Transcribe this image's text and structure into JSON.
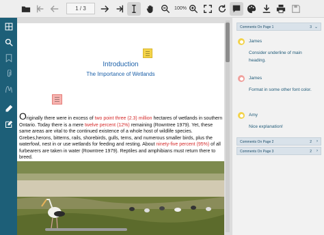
{
  "toolbar": {
    "page_indicator": "1 / 3",
    "zoom_level": "100%",
    "icons": [
      "folder-open-icon",
      "first-page-icon",
      "previous-page-icon",
      "next-page-icon",
      "last-page-icon",
      "text-select-icon",
      "pan-hand-icon",
      "zoom-out-icon",
      "zoom-in-icon",
      "fit-page-icon",
      "rotate-icon",
      "comments-panel-icon",
      "palette-icon",
      "download-icon",
      "print-icon",
      "save-icon"
    ]
  },
  "sidebar": {
    "icons": [
      "thumbnails-icon",
      "search-icon",
      "bookmark-icon",
      "attachment-icon",
      "signature-icon",
      "annotate-pen-icon",
      "edit-note-icon"
    ]
  },
  "document": {
    "title": "Introduction",
    "subtitle": "The Importance of Wetlands",
    "paragraph": {
      "dropcap": "O",
      "p1": "riginally there were in excess of ",
      "h1": "two point three (2.3) million",
      "p2": " hectares of wetlands in southern Ontario. Today there is a mere ",
      "h2": "twelve percent (12%)",
      "p3": " remaining (Rowntree 1979). Yet, these same areas are vital to the continued existence of a whole host of wildlife species. Grebes,herons, bitterns, rails, shorebirds, gulls, terns, and numerous smaller birds, plus the waterfowl, nest in or use wetlands for feeding and resting. About ",
      "h3": "ninety-five percent (95%)",
      "p4": " of all furbearers are taken in water (Rowntree 1979). Reptiles and amphibians must return there to breed."
    }
  },
  "comments": {
    "groups": [
      {
        "label": "Comments On Page 1",
        "count": "3",
        "chevron": "⌄"
      },
      {
        "label": "Comments On Page 2",
        "count": "2",
        "chevron": "›"
      },
      {
        "label": "Comments On Page 3",
        "count": "2",
        "chevron": "›"
      }
    ],
    "items": [
      {
        "author": "James",
        "text": "Consider underline of main heading.",
        "color": "yellow"
      },
      {
        "author": "James",
        "text": "Format in some other font color.",
        "color": "red"
      },
      {
        "author": "Amy",
        "text": "Nice explanation!",
        "color": "yellow"
      }
    ]
  },
  "colors": {
    "sidebar": "#1d5f78",
    "highlight_text": "#d42a2a",
    "heading": "#1a5fa8",
    "note_yellow": "#f4d44a",
    "note_red": "#f6b3b0"
  }
}
